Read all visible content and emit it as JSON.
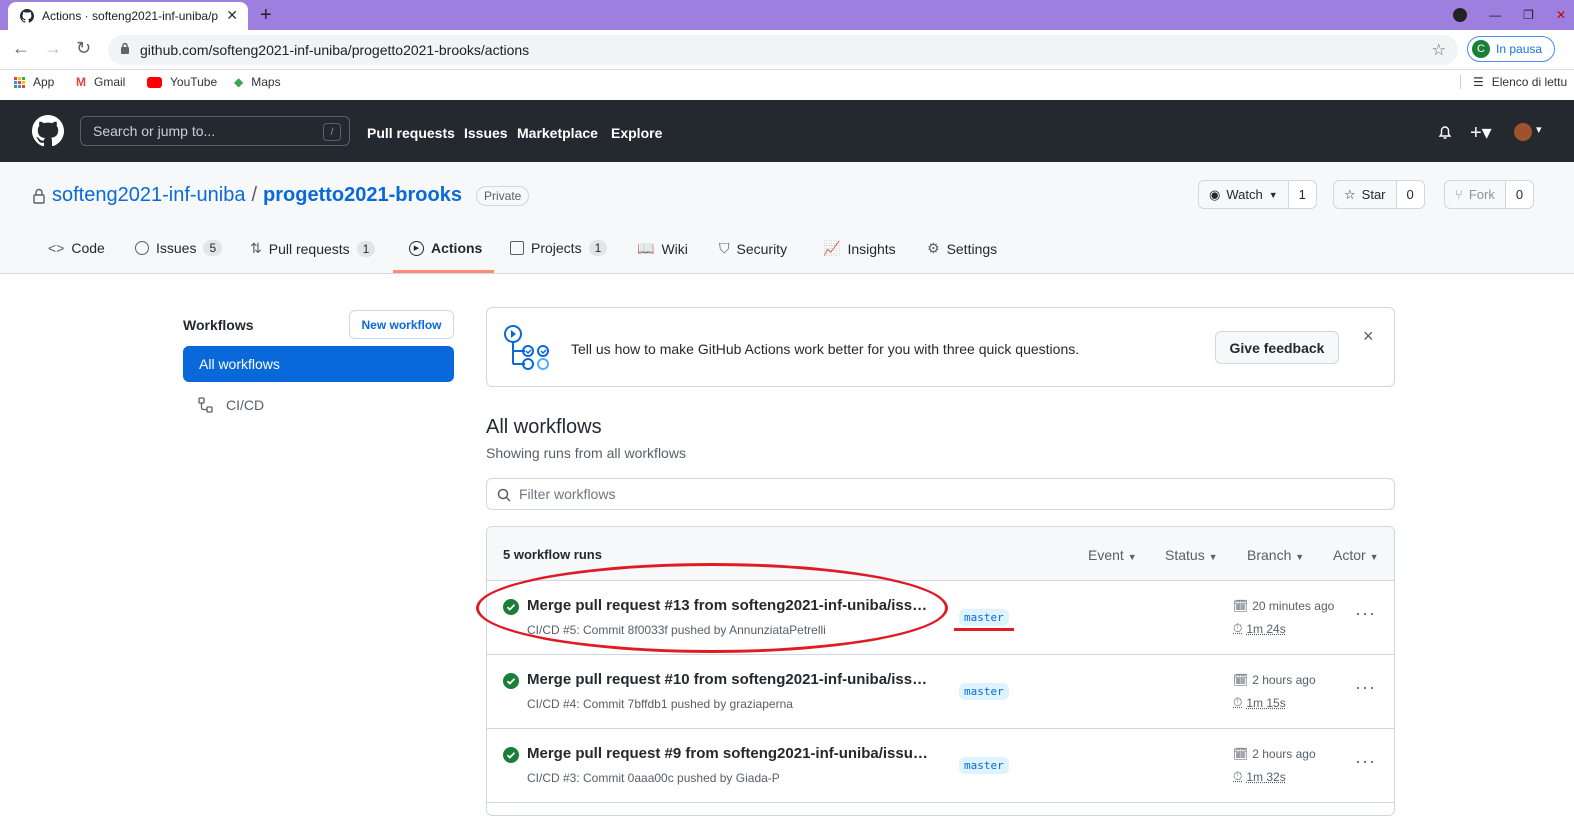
{
  "browser": {
    "tab_title": "Actions · softeng2021-inf-uniba/p",
    "url": "github.com/softeng2021-inf-uniba/progetto2021-brooks/actions",
    "profile_label": "In pausa",
    "profile_initial": "C",
    "bookmarks": [
      "App",
      "Gmail",
      "YouTube",
      "Maps"
    ],
    "reading_list": "Elenco di lettu"
  },
  "gh_header": {
    "search_placeholder": "Search or jump to...",
    "search_shortcut": "/",
    "nav": [
      "Pull requests",
      "Issues",
      "Marketplace",
      "Explore"
    ]
  },
  "repo": {
    "owner": "softeng2021-inf-uniba",
    "separator": "/",
    "name": "progetto2021-brooks",
    "visibility": "Private",
    "watch_label": "Watch",
    "watch_count": "1",
    "star_label": "Star",
    "star_count": "0",
    "fork_label": "Fork",
    "fork_count": "0",
    "tabs": [
      {
        "label": "Code",
        "count": ""
      },
      {
        "label": "Issues",
        "count": "5"
      },
      {
        "label": "Pull requests",
        "count": "1"
      },
      {
        "label": "Actions",
        "count": ""
      },
      {
        "label": "Projects",
        "count": "1"
      },
      {
        "label": "Wiki",
        "count": ""
      },
      {
        "label": "Security",
        "count": ""
      },
      {
        "label": "Insights",
        "count": ""
      },
      {
        "label": "Settings",
        "count": ""
      }
    ]
  },
  "sidebar": {
    "title": "Workflows",
    "new_workflow": "New workflow",
    "all_workflows": "All workflows",
    "workflow_items": [
      "CI/CD"
    ]
  },
  "banner": {
    "text": "Tell us how to make GitHub Actions work better for you with three quick questions.",
    "feedback_button": "Give feedback",
    "close": "×"
  },
  "main": {
    "heading": "All workflows",
    "subheading": "Showing runs from all workflows",
    "filter_placeholder": "Filter workflows",
    "runs_count": "5 workflow runs",
    "filters": [
      "Event",
      "Status",
      "Branch",
      "Actor"
    ],
    "runs": [
      {
        "title": "Merge pull request #13 from softeng2021-inf-uniba/iss…",
        "meta": "CI/CD #5: Commit 8f0033f pushed by AnnunziataPetrelli",
        "branch": "master",
        "time": "20 minutes ago",
        "duration": "1m 24s"
      },
      {
        "title": "Merge pull request #10 from softeng2021-inf-uniba/iss…",
        "meta": "CI/CD #4: Commit 7bffdb1 pushed by graziaperna",
        "branch": "master",
        "time": "2 hours ago",
        "duration": "1m 15s"
      },
      {
        "title": "Merge pull request #9 from softeng2021-inf-uniba/issu…",
        "meta": "CI/CD #3: Commit 0aaa00c pushed by Giada-P",
        "branch": "master",
        "time": "2 hours ago",
        "duration": "1m 32s"
      }
    ]
  },
  "colors": {
    "accent": "#0969da",
    "success": "#1a7f37",
    "annotation": "#e01b24",
    "header_bg": "#24292f",
    "tabbar_bg": "#9d7fe0"
  }
}
